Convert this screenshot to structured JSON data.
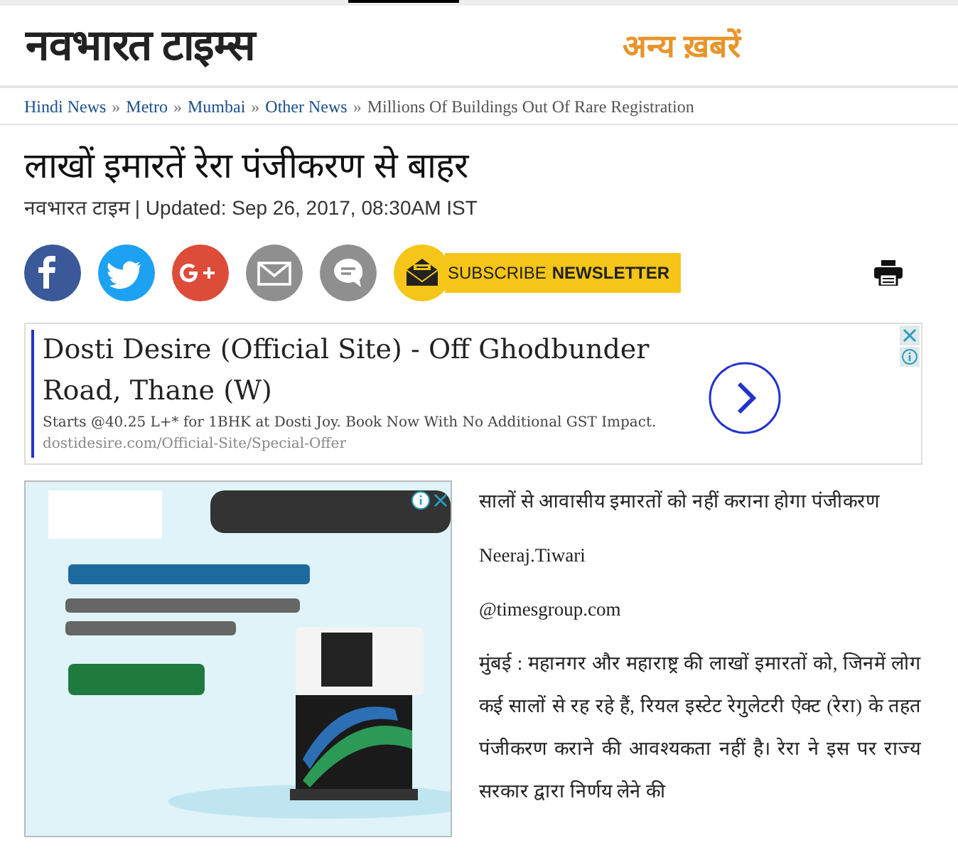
{
  "header": {
    "logo": "नवभारत टाइम्स",
    "other_news": "अन्य ख़बरें"
  },
  "breadcrumb": [
    {
      "label": "Hindi News",
      "kind": "link"
    },
    {
      "label": "Metro",
      "kind": "link"
    },
    {
      "label": "Mumbai",
      "kind": "link"
    },
    {
      "label": "Other News",
      "kind": "link"
    },
    {
      "label": "Millions Of Buildings Out Of Rare Registration",
      "kind": "current"
    }
  ],
  "breadcrumb_separator": "»",
  "article": {
    "title": "लाखों इमारतें रेरा पंजीकरण से बाहर",
    "source": "नवभारत टाइम",
    "updated": "| Updated: Sep 26, 2017, 08:30AM IST",
    "share_buttons": [
      {
        "kind": "facebook"
      },
      {
        "kind": "twitter"
      },
      {
        "kind": "google"
      },
      {
        "kind": "email"
      },
      {
        "kind": "comment"
      }
    ],
    "subscribe": {
      "label": "SUBSCRIBE",
      "label_bold": "NEWSLETTER"
    },
    "body": [
      {
        "text": "सालों से आवासीय इमारतों को नहीं कराना होगा पंजीकरण"
      },
      {
        "text": "Neeraj.Tiwari"
      },
      {
        "text": "@timesgroup.com"
      },
      {
        "text": "मुंबई : महानगर और महाराष्ट्र की लाखों इमारतों को, जिनमें लोग कई सालों से रह रहे हैं, रियल इस्टेट रेगुलेटरी ऐक्ट (रेरा) के तहत पंजीकरण कराने की आवश्यकता नहीं है। रेरा ने इस पर राज्य सरकार द्वारा निर्णय लेने की"
      }
    ]
  },
  "text_ad": {
    "headline": "Dosti Desire (Official Site) - Off Ghodbunder Road, Thane (W)",
    "description": "Starts @40.25 L+* for 1BHK at Dosti Joy. Book Now With No Additional GST Impact.",
    "url": "dostidesire.com/Official-Site/Special-Offer"
  }
}
